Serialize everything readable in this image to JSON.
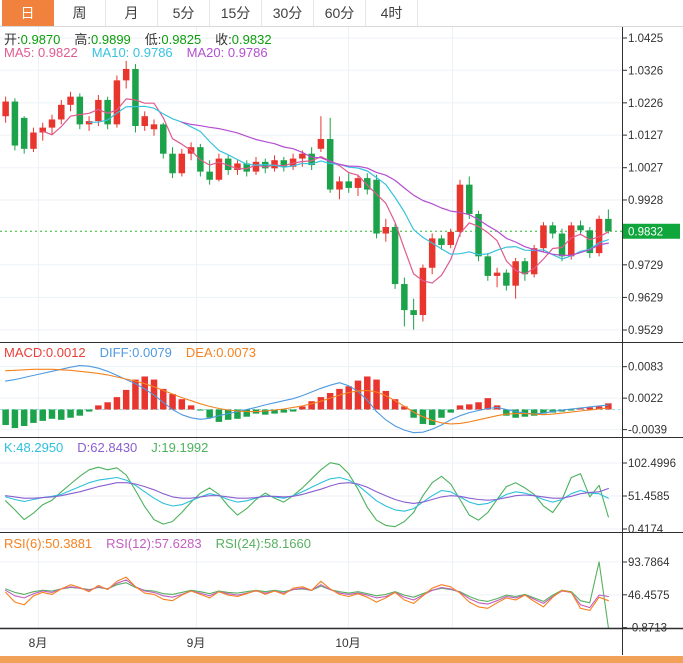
{
  "tabs": {
    "items": [
      "日",
      "周",
      "月",
      "5分",
      "15分",
      "30分",
      "60分",
      "4时"
    ],
    "active": "日"
  },
  "main": {
    "ohlc": [
      {
        "label": "开:",
        "value": "0.9870"
      },
      {
        "label": "高:",
        "value": "0.9899"
      },
      {
        "label": "低:",
        "value": "0.9825"
      },
      {
        "label": "收:",
        "value": "0.9832"
      }
    ],
    "ma_legend": [
      {
        "text": "MA5: 0.9822",
        "color": "#e05a8f"
      },
      {
        "text": "MA10: 0.9786",
        "color": "#38c2dd"
      },
      {
        "text": "MA20: 0.9786",
        "color": "#b44fd0"
      }
    ]
  },
  "macd_legend": [
    {
      "text": "MACD:0.0012",
      "color": "#e83e36"
    },
    {
      "text": "DIFF:0.0079",
      "color": "#4f9ae0"
    },
    {
      "text": "DEA:0.0073",
      "color": "#f5821f"
    }
  ],
  "kdj_legend": [
    {
      "text": "K:48.2950",
      "color": "#2cc0dc"
    },
    {
      "text": "D:62.8430",
      "color": "#8a5fd0"
    },
    {
      "text": "J:19.1992",
      "color": "#4cb25c"
    }
  ],
  "rsi_legend": [
    {
      "text": "RSI(6):50.3881",
      "color": "#f58220"
    },
    {
      "text": "RSI(12):57.6283",
      "color": "#c25ec2"
    },
    {
      "text": "RSI(24):58.1660",
      "color": "#57b060"
    }
  ],
  "colors": {
    "up": "#e8352e",
    "down": "#1ba24a",
    "grid": "#edf2f8",
    "axis_text": "#333333",
    "separator": "#2f2f2f",
    "price_badge": "#0fa63c",
    "price_line": "#2db82d",
    "zero_line": "#9adcec",
    "tab_active_bg": "#f0823d",
    "bottom_bar": "#f2a158",
    "ohlc_value": "#0a9e0a",
    "ohlc_label": "#333333"
  },
  "chart_data": [
    {
      "type": "candlestick",
      "period": "日",
      "title": "",
      "y_ticks": [
        "1.0425",
        "1.0326",
        "1.0226",
        "1.0127",
        "1.0027",
        "0.9928",
        "0.9729",
        "0.9629",
        "0.9529"
      ],
      "current_price": "0.9832",
      "open": 0.987,
      "high": 0.9899,
      "low": 0.9825,
      "close": 0.9832,
      "ma5": 0.9822,
      "ma10": 0.9786,
      "ma20": 0.9786,
      "x_labels": [
        "8月",
        "9月",
        "10月"
      ],
      "candles": [
        [
          1.0185,
          1.0245,
          1.0165,
          1.023
        ],
        [
          1.023,
          1.024,
          1.008,
          1.0095
        ],
        [
          1.018,
          1.0185,
          1.007,
          1.0085
        ],
        [
          1.0085,
          1.015,
          1.0075,
          1.0135
        ],
        [
          1.0135,
          1.0165,
          1.011,
          1.015
        ],
        [
          1.015,
          1.019,
          1.013,
          1.0175
        ],
        [
          1.0175,
          1.0235,
          1.016,
          1.022
        ],
        [
          1.022,
          1.026,
          1.02,
          1.0245
        ],
        [
          1.0245,
          1.0255,
          1.0145,
          1.016
        ],
        [
          1.016,
          1.0185,
          1.014,
          1.017
        ],
        [
          1.017,
          1.025,
          1.0155,
          1.0235
        ],
        [
          1.0235,
          1.0245,
          1.0145,
          1.016
        ],
        [
          1.016,
          1.031,
          1.015,
          1.0295
        ],
        [
          1.0295,
          1.0355,
          1.027,
          1.033
        ],
        [
          1.033,
          1.0345,
          1.0135,
          1.0155
        ],
        [
          1.0155,
          1.02,
          1.014,
          1.0185
        ],
        [
          1.0145,
          1.0175,
          1.0125,
          1.016
        ],
        [
          1.016,
          1.0165,
          1.0055,
          1.007
        ],
        [
          1.007,
          1.009,
          0.9995,
          1.001
        ],
        [
          1.001,
          1.0085,
          1.0,
          1.007
        ],
        [
          1.007,
          1.0105,
          1.005,
          1.009
        ],
        [
          1.009,
          1.01,
          1.0,
          1.0015
        ],
        [
          1.0015,
          1.005,
          0.9975,
          0.999
        ],
        [
          0.999,
          1.007,
          0.9985,
          1.0055
        ],
        [
          1.0055,
          1.0065,
          1.0005,
          1.002
        ],
        [
          1.002,
          1.005,
          1.0005,
          1.004
        ],
        [
          1.004,
          1.005,
          1.0,
          1.0015
        ],
        [
          1.0015,
          1.006,
          1.0005,
          1.0045
        ],
        [
          1.0045,
          1.0055,
          1.001,
          1.0025
        ],
        [
          1.0025,
          1.0065,
          1.0015,
          1.005
        ],
        [
          1.005,
          1.006,
          1.0015,
          1.003
        ],
        [
          1.003,
          1.007,
          1.002,
          1.0055
        ],
        [
          1.0055,
          1.008,
          1.003,
          1.007
        ],
        [
          1.007,
          1.009,
          1.002,
          1.0035
        ],
        [
          1.0085,
          1.0185,
          1.0075,
          1.0115
        ],
        [
          1.0115,
          1.018,
          0.995,
          0.996
        ],
        [
          0.996,
          1.0,
          0.993,
          0.9985
        ],
        [
          0.9985,
          1.001,
          0.995,
          0.9965
        ],
        [
          0.9965,
          1.0005,
          0.994,
          0.9995
        ],
        [
          0.9995,
          1.001,
          0.9945,
          0.996
        ],
        [
          0.999,
          1.0005,
          0.981,
          0.9825
        ],
        [
          0.9825,
          0.987,
          0.98,
          0.9845
        ],
        [
          0.9845,
          0.9855,
          0.9655,
          0.967
        ],
        [
          0.967,
          0.969,
          0.954,
          0.959
        ],
        [
          0.959,
          0.9625,
          0.953,
          0.9575
        ],
        [
          0.9575,
          0.973,
          0.9555,
          0.972
        ],
        [
          0.972,
          0.9825,
          0.97,
          0.981
        ],
        [
          0.981,
          0.982,
          0.9775,
          0.979
        ],
        [
          0.979,
          0.984,
          0.978,
          0.983
        ],
        [
          0.983,
          0.999,
          0.9815,
          0.9975
        ],
        [
          0.9975,
          1.0,
          0.987,
          0.9885
        ],
        [
          0.9885,
          0.9895,
          0.974,
          0.9755
        ],
        [
          0.9755,
          0.9765,
          0.968,
          0.9695
        ],
        [
          0.9695,
          0.972,
          0.966,
          0.9705
        ],
        [
          0.9705,
          0.9715,
          0.965,
          0.9665
        ],
        [
          0.9665,
          0.975,
          0.9625,
          0.974
        ],
        [
          0.974,
          0.975,
          0.968,
          0.97
        ],
        [
          0.97,
          0.979,
          0.969,
          0.978
        ],
        [
          0.978,
          0.986,
          0.977,
          0.985
        ],
        [
          0.985,
          0.986,
          0.981,
          0.9825
        ],
        [
          0.9825,
          0.984,
          0.974,
          0.9755
        ],
        [
          0.9755,
          0.986,
          0.9745,
          0.985
        ],
        [
          0.985,
          0.9865,
          0.982,
          0.9835
        ],
        [
          0.9835,
          0.9845,
          0.975,
          0.9765
        ],
        [
          0.9765,
          0.988,
          0.9755,
          0.987
        ],
        [
          0.987,
          0.9899,
          0.9825,
          0.9832
        ]
      ]
    },
    {
      "type": "bar",
      "name": "MACD",
      "macd": 0.0012,
      "diff": 0.0079,
      "dea": 0.0073,
      "y_ticks": [
        "0.0083",
        "0.0022",
        "-0.0039"
      ],
      "value_unit": 0.0001,
      "histogram": [
        -30,
        -36,
        -32,
        -26,
        -22,
        -18,
        -20,
        -16,
        -12,
        -4,
        8,
        14,
        24,
        38,
        58,
        64,
        58,
        40,
        30,
        20,
        8,
        -2,
        -16,
        -24,
        -20,
        -18,
        -14,
        -8,
        -10,
        -8,
        -6,
        -4,
        6,
        16,
        24,
        32,
        40,
        45,
        56,
        64,
        58,
        36,
        20,
        6,
        -16,
        -28,
        -30,
        -16,
        -6,
        8,
        10,
        14,
        22,
        8,
        -12,
        -16,
        -14,
        -12,
        -8,
        -6,
        -4,
        -2,
        2,
        4,
        6,
        12
      ],
      "diff_line": [
        55,
        58,
        62,
        66,
        70,
        74,
        78,
        82,
        85,
        84,
        80,
        74,
        66,
        58,
        50,
        40,
        28,
        14,
        0,
        -10,
        -16,
        -19,
        -17,
        -12,
        -8,
        -4,
        0,
        4,
        9,
        13,
        17,
        21,
        27,
        34,
        41,
        47,
        52,
        46,
        35,
        18,
        -4,
        -20,
        -32,
        -40,
        -45,
        -44,
        -38,
        -30,
        -20,
        -12,
        -6,
        -2,
        2,
        4,
        0,
        -4,
        -7,
        -9,
        -7,
        -4,
        -1,
        1,
        3,
        5,
        7,
        9
      ],
      "dea_line": [
        75,
        76,
        77,
        78,
        78,
        78,
        77,
        76,
        74,
        72,
        70,
        67,
        63,
        59,
        55,
        50,
        44,
        37,
        30,
        23,
        17,
        11,
        6,
        2,
        -1,
        -3,
        -4,
        -4,
        -3,
        -1,
        1,
        4,
        7,
        11,
        16,
        22,
        28,
        33,
        36,
        37,
        34,
        27,
        17,
        6,
        -5,
        -14,
        -21,
        -26,
        -28,
        -27,
        -24,
        -20,
        -16,
        -12,
        -9,
        -8,
        -8,
        -9,
        -10,
        -9,
        -7,
        -5,
        -3,
        -1,
        1,
        3
      ]
    },
    {
      "type": "line",
      "name": "KDJ",
      "k": 48.295,
      "d": 62.843,
      "j": 19.1992,
      "y_ticks": [
        "102.4996",
        "51.4585",
        "0.4174"
      ],
      "k_line": [
        50,
        46,
        43,
        46,
        49,
        51,
        54,
        60,
        66,
        72,
        76,
        78,
        80,
        76,
        68,
        58,
        48,
        40,
        36,
        38,
        44,
        50,
        55,
        52,
        46,
        42,
        44,
        48,
        52,
        50,
        48,
        52,
        58,
        65,
        72,
        78,
        80,
        76,
        68,
        56,
        44,
        36,
        30,
        28,
        32,
        42,
        52,
        60,
        58,
        50,
        42,
        38,
        40,
        46,
        54,
        58,
        56,
        52,
        46,
        42,
        46,
        55,
        60,
        56,
        55,
        48
      ],
      "d_line": [
        52,
        50,
        48,
        48,
        49,
        50,
        52,
        55,
        58,
        62,
        66,
        69,
        72,
        72,
        70,
        66,
        61,
        55,
        50,
        48,
        48,
        50,
        52,
        52,
        50,
        48,
        48,
        49,
        51,
        51,
        50,
        51,
        54,
        58,
        62,
        67,
        71,
        72,
        70,
        65,
        58,
        52,
        46,
        42,
        40,
        42,
        46,
        50,
        52,
        51,
        48,
        46,
        45,
        46,
        49,
        52,
        53,
        52,
        50,
        48,
        48,
        51,
        55,
        57,
        58,
        63
      ],
      "j_line": [
        44,
        30,
        15,
        25,
        38,
        45,
        58,
        70,
        82,
        92,
        96,
        92,
        95,
        84,
        60,
        35,
        15,
        8,
        12,
        26,
        42,
        56,
        64,
        54,
        36,
        22,
        32,
        46,
        56,
        48,
        42,
        52,
        64,
        78,
        92,
        103,
        100,
        86,
        62,
        34,
        14,
        6,
        4,
        12,
        26,
        52,
        72,
        82,
        70,
        46,
        22,
        14,
        26,
        46,
        66,
        72,
        64,
        54,
        36,
        26,
        46,
        80,
        86,
        50,
        68,
        19
      ]
    },
    {
      "type": "line",
      "name": "RSI",
      "rsi6": 50.3881,
      "rsi12": 57.6283,
      "rsi24": 58.166,
      "y_ticks": [
        "93.7864",
        "46.4575",
        "-0.8713"
      ],
      "rsi6_line": [
        50,
        36,
        32,
        45,
        50,
        47,
        55,
        61,
        57,
        51,
        60,
        54,
        66,
        72,
        58,
        49,
        47,
        40,
        38,
        46,
        52,
        47,
        42,
        51,
        46,
        44,
        48,
        53,
        47,
        52,
        47,
        56,
        58,
        53,
        66,
        55,
        47,
        44,
        48,
        43,
        36,
        42,
        50,
        39,
        34,
        45,
        56,
        61,
        58,
        49,
        36,
        29,
        27,
        35,
        42,
        39,
        46,
        37,
        29,
        43,
        53,
        50,
        27,
        24,
        43,
        38
      ],
      "rsi12_line": [
        53,
        45,
        42,
        48,
        52,
        50,
        55,
        58,
        56,
        53,
        58,
        55,
        63,
        68,
        58,
        52,
        50,
        45,
        43,
        47,
        52,
        49,
        45,
        51,
        48,
        46,
        49,
        52,
        49,
        52,
        49,
        54,
        56,
        53,
        61,
        54,
        49,
        47,
        49,
        46,
        42,
        44,
        50,
        43,
        39,
        46,
        53,
        57,
        55,
        50,
        41,
        35,
        33,
        38,
        44,
        42,
        46,
        40,
        34,
        44,
        52,
        50,
        32,
        28,
        46,
        44
      ],
      "rsi24_line": [
        55,
        50,
        47,
        51,
        53,
        52,
        55,
        57,
        56,
        54,
        57,
        55,
        61,
        64,
        57,
        53,
        52,
        48,
        47,
        50,
        53,
        51,
        48,
        52,
        50,
        49,
        51,
        53,
        51,
        53,
        51,
        54,
        55,
        53,
        59,
        54,
        51,
        49,
        51,
        48,
        45,
        47,
        51,
        46,
        43,
        48,
        53,
        56,
        54,
        51,
        44,
        39,
        37,
        41,
        46,
        44,
        47,
        42,
        37,
        46,
        53,
        51,
        38,
        35,
        94,
        -1
      ]
    }
  ]
}
